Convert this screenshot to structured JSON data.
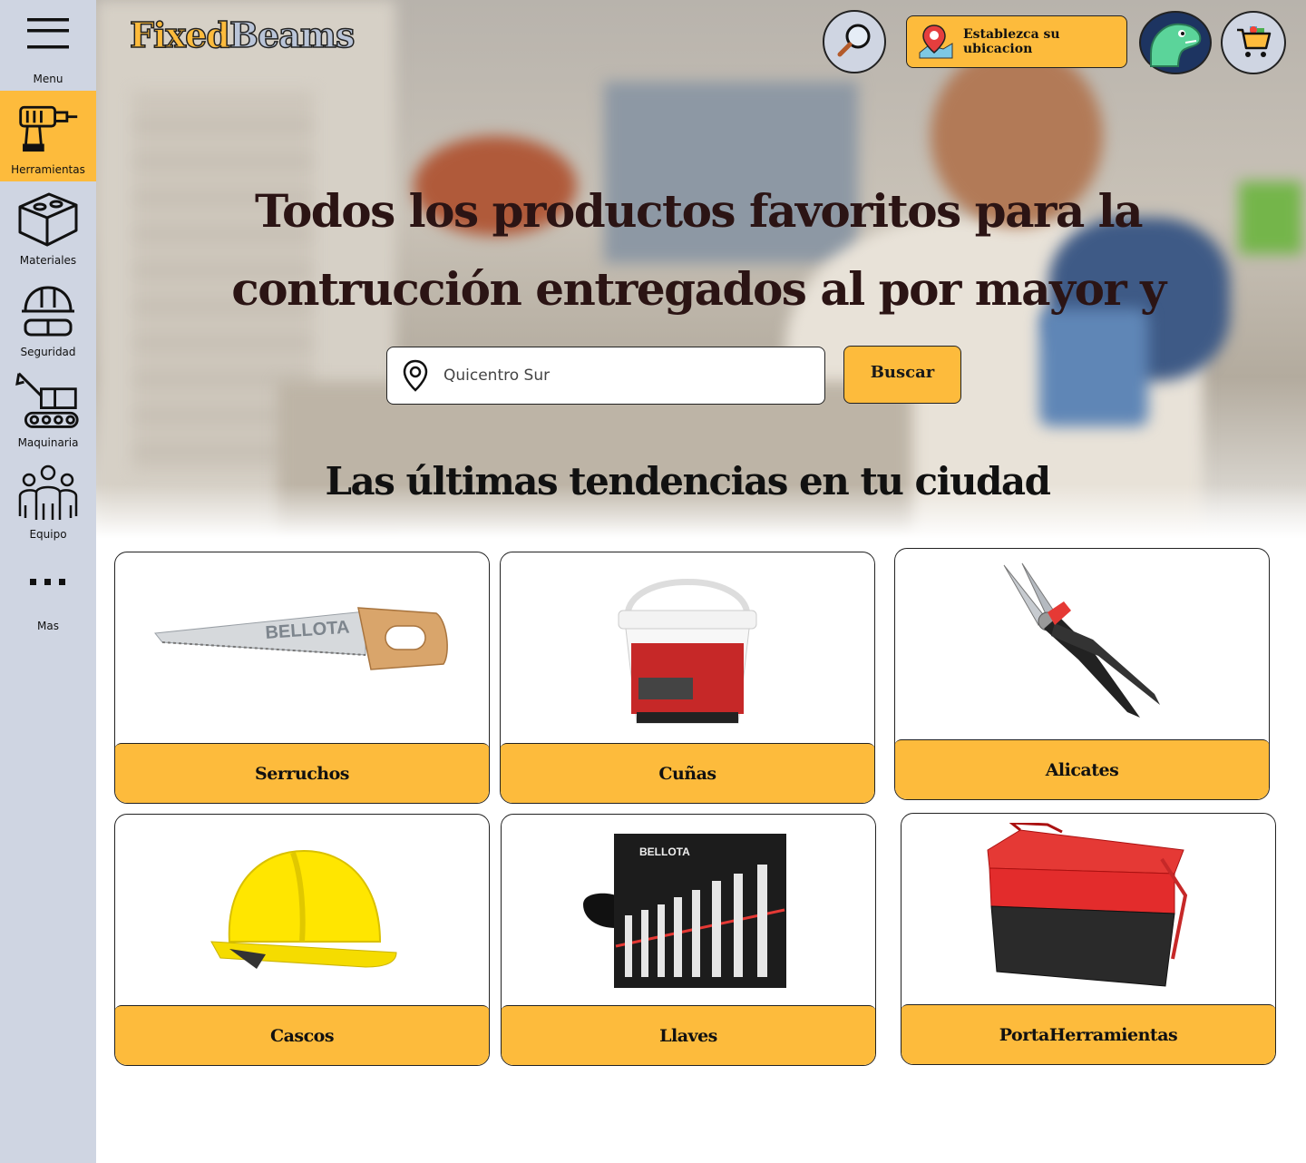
{
  "app": {
    "logo_part1": "Fixed",
    "logo_part2": "Beams"
  },
  "sidebar": {
    "items": [
      {
        "label": "Menu",
        "icon": "hamburger-icon"
      },
      {
        "label": "Herramientas",
        "icon": "drill-icon",
        "active": true
      },
      {
        "label": "Materiales",
        "icon": "brick-icon"
      },
      {
        "label": "Seguridad",
        "icon": "helmet-goggles-icon"
      },
      {
        "label": "Maquinaria",
        "icon": "excavator-icon"
      },
      {
        "label": "Equipo",
        "icon": "team-icon"
      },
      {
        "label": "Mas",
        "icon": "more-dots-icon"
      }
    ]
  },
  "header": {
    "location_button": "Establezca su ubicacion",
    "search_icon": "magnifier-icon",
    "avatar_icon": "dinosaur-avatar-icon",
    "cart_icon": "cart-icon"
  },
  "hero": {
    "title_line1": "Todos los productos favoritos para la",
    "title_line2": "contrucción entregados al por mayor y menor",
    "search_value": "Quicentro Sur",
    "search_button": "Buscar",
    "section_title": "Las últimas tendencias en tu ciudad"
  },
  "categories": [
    {
      "label": "Serruchos",
      "icon": "hand-saw-icon"
    },
    {
      "label": "Cuñas",
      "icon": "bucket-icon"
    },
    {
      "label": "Alicates",
      "icon": "pliers-icon"
    },
    {
      "label": "Cascos",
      "icon": "hard-hat-icon"
    },
    {
      "label": "Llaves",
      "icon": "wrench-set-icon"
    },
    {
      "label": "PortaHerramientas",
      "icon": "toolbox-icon"
    }
  ],
  "colors": {
    "accent": "#fdbb3c",
    "sidebar": "#cfd5e2",
    "title": "#2b1414"
  }
}
